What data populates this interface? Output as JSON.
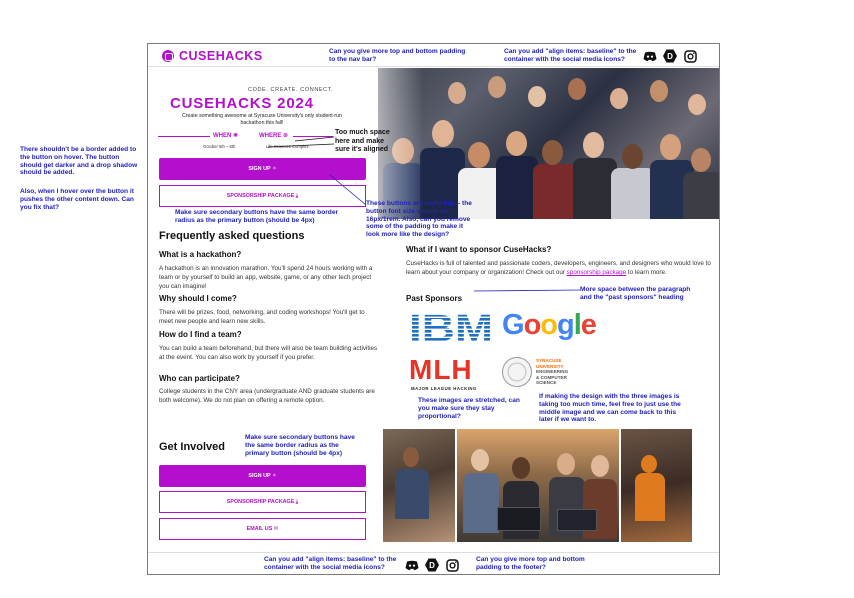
{
  "nav": {
    "brand": "CUSEHACKS"
  },
  "hero": {
    "tagline": "CODE. CREATE. CONNECT.",
    "title": "CUSEHACKS 2024",
    "subtitle": "Create something awesome at Syracuse University's only student-run hackathon this fall!",
    "when_label": "WHEN",
    "where_label": "WHERE",
    "when_value": "October 5th – 6th",
    "where_value": "Life Sciences Complex"
  },
  "buttons": {
    "sign_up": "SIGN UP",
    "sponsorship": "SPONSORSHIP PACKAGE",
    "email": "EMAIL US"
  },
  "faq": {
    "title": "Frequently asked questions",
    "items": [
      {
        "q": "What is a hackathon?",
        "a": "A hackathon is an innovation marathon. You'll spend 24 hours working with a team or by yourself to build an app, website, game, or any other tech project you can imagine!"
      },
      {
        "q": "Why should I come?",
        "a": "There will be prizes, food, networking, and coding workshops! You'll get to meet new people and learn new skills."
      },
      {
        "q": "How do I find a team?",
        "a": "You can build a team beforehand, but there will also be team building activities at the event. You can also work by yourself if you prefer."
      },
      {
        "q": "Who can participate?",
        "a": "College students in the CNY area (undergraduate AND graduate students are both welcome). We do not plan on offering a remote option."
      }
    ]
  },
  "get_involved": {
    "title": "Get Involved"
  },
  "sponsor": {
    "title": "What if I want to sponsor CuseHacks?",
    "text_before": "CuseHacks is full of talented and passionate coders, developers, engineers, and designers who would love to learn about your company or organization! Check out our ",
    "link": "sponsorship package",
    "text_after": " to learn more.",
    "past_title": "Past Sponsors",
    "logos": {
      "ibm": "IBM",
      "google": "Google",
      "mlh": "MLH",
      "mlh_sub": "MAJOR LEAGUE HACKING",
      "su_lines": [
        "SYRACUSE",
        "UNIVERSITY",
        "ENGINEERING",
        "& COMPUTER",
        "SCIENCE"
      ]
    }
  },
  "notes": {
    "nav_padding": "Can you give more top and bottom padding to the nav bar?",
    "nav_align": "Can you add \"align items: baseline\" to the container with the social media icons?",
    "hover_border": "There shouldn't be a border added to the button on hover. The button should get darker and a drop shadow should be added.",
    "hover_push": "Also, when I hover over the button it pushes the other content down. Can you fix that?",
    "too_much_space": "Too much space here and make sure it's aligned",
    "secondary_radius_top": "Make sure secondary buttons have the same border radius as the primary button (should be 4px)",
    "buttons_big": "These buttons are really big— the button font size should be 16px/1rem. Also, can you remove some of the padding to make it look more like the design?",
    "more_space": "More space between the paragraph and the \"past sponsors\" heading",
    "stretched": "These images are stretched, can you make sure they stay proportional?",
    "three_images": "If making the design with the three images is taking too much time, feel free to just use the middle image and we can come back to this later if we want to.",
    "secondary_radius_bottom": "Make sure secondary buttons have the same border radius as the primary button (should be 4px)",
    "footer_align": "Can you add \"align items: baseline\" to the container with the social media icons?",
    "footer_padding": "Can you give more top and bottom padding to the footer?"
  },
  "colors": {
    "brand": "#b30fcc",
    "annotation": "#2222bb"
  },
  "icons": [
    "discord-icon",
    "devpost-icon",
    "instagram-icon",
    "cusehacks-logo-icon",
    "sparkle-icon",
    "download-icon",
    "mail-icon"
  ]
}
